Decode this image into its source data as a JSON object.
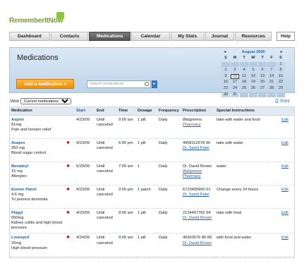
{
  "brand": {
    "name": "RememberItNow"
  },
  "nav": [
    "Dashboard",
    "Contacts",
    "Medications",
    "Calendar",
    "My Stats",
    "Journal",
    "Resources"
  ],
  "help": "Help",
  "panel": {
    "title": "Medications",
    "add_label": "Add a medication »",
    "search_placeholder": "Search medications"
  },
  "calendar": {
    "month": "August 2009",
    "prev": "◄",
    "next": "►",
    "dow": [
      "S",
      "M",
      "T",
      "W",
      "T",
      "F",
      "S"
    ],
    "days": [
      "",
      "",
      "",
      "",
      "",
      "",
      "1",
      "2",
      "3",
      "4",
      "5",
      "6",
      "7",
      "8",
      "9",
      "10",
      "11",
      "12",
      "13",
      "14",
      "15",
      "16",
      "17",
      "18",
      "19",
      "20",
      "21",
      "22",
      "23",
      "24",
      "25",
      "26",
      "27",
      "28",
      "29",
      "30",
      "31",
      "",
      "",
      "",
      "",
      ""
    ],
    "today": "10"
  },
  "view": {
    "label": "View",
    "selected": "Current medications"
  },
  "print": "Print",
  "table": {
    "headers": [
      "Medication",
      "",
      "Start",
      "End",
      "Time",
      "Dosage",
      "Frequency",
      "Prescription",
      "Special Instructions",
      ""
    ],
    "rows": [
      {
        "name": "Asprin",
        "dose": "81mg",
        "note": "Pain and tension relief",
        "alert": "",
        "start": "4/23/09",
        "end": "Until canceled",
        "time": "9:00 am",
        "dosage": "1 pill",
        "freq": "Daily",
        "rx1": "Walgreens",
        "rx2": "Pharmacy",
        "instr": "take with water and food",
        "edit": "Edit"
      },
      {
        "name": "Avapro",
        "dose": "350 mg",
        "note": "Blood sugar control",
        "alert": "✱",
        "start": "4/23/09",
        "end": "Until canceled",
        "time": "6:00 pm",
        "dosage": "1 pill",
        "freq": "Daily",
        "rx1": "4908112678 90",
        "rx2": "Dr. Samil Patel",
        "instr": "take with water",
        "edit": "Edit"
      },
      {
        "name": "Benadryl",
        "dose": "15 mg",
        "note": "Allergies",
        "alert": "✱",
        "start": "5/29/09",
        "end": "Until canceled",
        "time": "7:00 am",
        "dosage": "1",
        "freq": "Daily",
        "rx1": "Dr. David Brown",
        "rx2": "Walgreens Pharmacy",
        "instr": "water",
        "edit": "Edit"
      },
      {
        "name": "Exelon Patch",
        "dose": "4.6 mg",
        "note": "To prevent dementia",
        "alert": "✱",
        "start": "4/23/09",
        "end": "Until canceled",
        "time": "3:00 pm",
        "dosage": "1 patch",
        "freq": "Daily",
        "rx1": "6723405990 01",
        "rx2": "Dr. Samil Patel",
        "instr": "Change every 24 hours",
        "edit": "Edit"
      },
      {
        "name": "Plagyl",
        "dose": "500mg",
        "note": "Kidney colitis and high blood pressure",
        "alert": "✱",
        "start": "4/23/09",
        "end": "Until canceled",
        "time": "9:00 am",
        "dosage": "1 pill",
        "freq": "Daily",
        "rx1": "2134457782 64",
        "rx2": "Dr. David Brown",
        "instr": "take with food",
        "edit": "Edit"
      },
      {
        "name": "Lisinopril",
        "dose": "20mg",
        "note": "High blood pressure",
        "alert": "✱",
        "start": "4/24/09",
        "end": "Until canceled",
        "time": "9:00 am",
        "dosage": "1 pill",
        "freq": "Daily",
        "rx1": "45693676 86 89",
        "rx2": "Dr. David Brown",
        "instr": "with food and water",
        "edit": "Edit"
      }
    ]
  }
}
